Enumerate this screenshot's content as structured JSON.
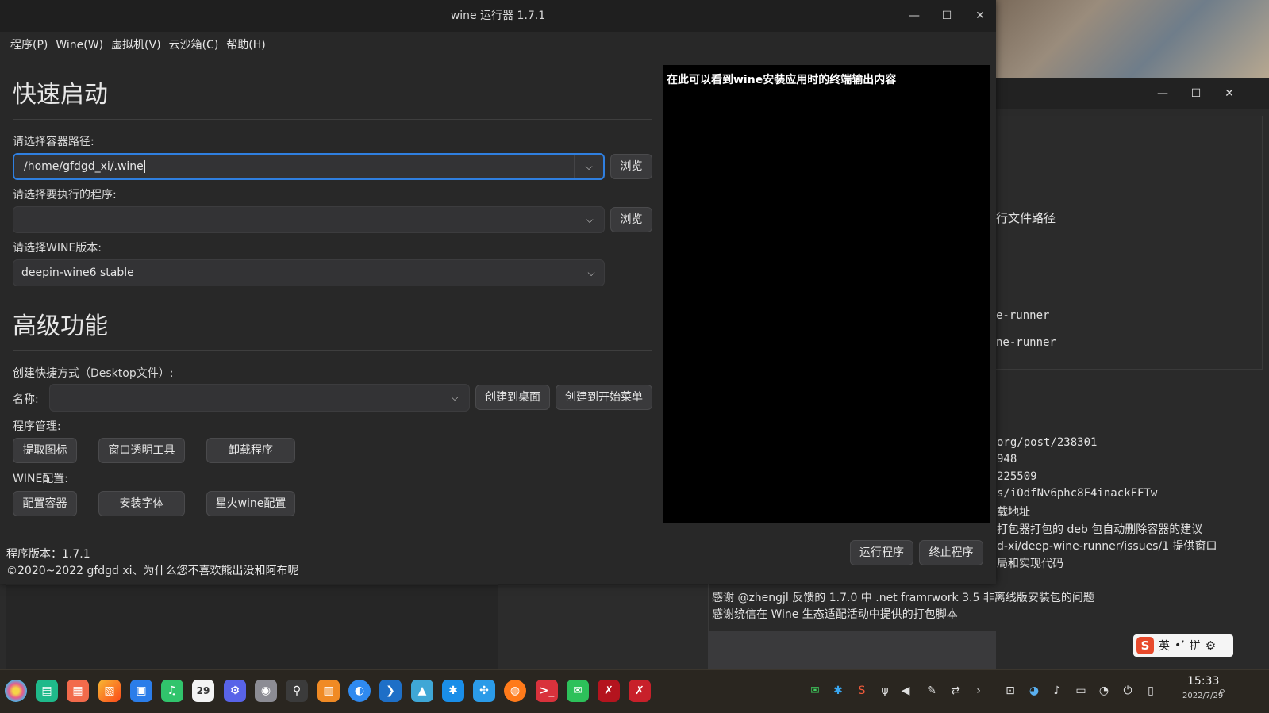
{
  "app": {
    "title": "wine 运行器 1.7.1",
    "menu": [
      "程序(P)",
      "Wine(W)",
      "虚拟机(V)",
      "云沙箱(C)",
      "帮助(H)"
    ],
    "quick_start_title": "快速启动",
    "container_label": "请选择容器路径:",
    "container_value": "/home/gfdgd_xi/.wine",
    "browse_label": "浏览",
    "program_label": "请选择要执行的程序:",
    "program_value": "",
    "wine_version_label": "请选择WINE版本:",
    "wine_version_value": "deepin-wine6 stable",
    "advanced_title": "高级功能",
    "shortcut_label": "创建快捷方式（Desktop文件）:",
    "name_label": "名称:",
    "name_value": "",
    "create_desktop": "创建到桌面",
    "create_menu": "创建到开始菜单",
    "program_mgmt_label": "程序管理:",
    "extract_icon": "提取图标",
    "window_transparency": "窗口透明工具",
    "uninstall_program": "卸载程序",
    "wine_config_label": "WINE配置:",
    "configure_container": "配置容器",
    "install_fonts": "安装字体",
    "spark_wine_config": "星火wine配置",
    "terminal_hint": "在此可以看到wine安装应用时的终端输出内容",
    "version_text": "程序版本：1.7.1",
    "copyright_text": "©2020~2022 gfdgd xi、为什么您不喜欢熊出没和阿布呢",
    "run_program": "运行程序",
    "stop_program": "终止程序"
  },
  "background": {
    "terminal_lines": [
      "行文件路径",
      "e-runner",
      "ne-runner",
      "org/post/238301",
      "948",
      "225509",
      "s/iOdfNv6phc8F4inackFFTw",
      "载地址",
      "打包器打包的 deb 包自动删除容器的建议",
      "d-xi/deep-wine-runner/issues/1 提供窗口",
      "局和实现代码",
      "感谢 @zhengjl 反馈的 1.7.0 中 .net framrwork 3.5 非离线版安装包的问题",
      "感谢统信在 Wine 生态适配活动中提供的打包脚本"
    ]
  },
  "ime": {
    "logo": "S",
    "lang": "英",
    "punct": "•’",
    "mode": "拼"
  },
  "taskbar": {
    "time": "15:33",
    "date": "2022/7/29",
    "calendar_day": "29"
  },
  "colors": {
    "accent": "#2f7fe0",
    "window_bg": "#282828",
    "terminal_bg": "#000000"
  }
}
